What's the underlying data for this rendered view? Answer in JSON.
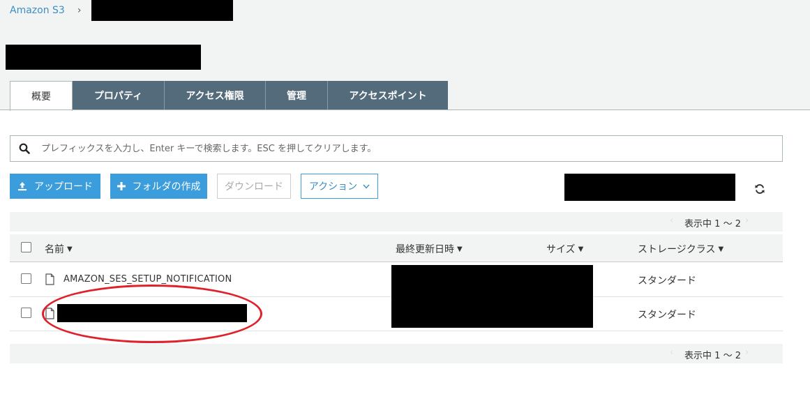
{
  "breadcrumb": {
    "root": "Amazon S3",
    "separator": "›"
  },
  "tabs": [
    {
      "label": "概要",
      "active": true
    },
    {
      "label": "プロパティ",
      "active": false
    },
    {
      "label": "アクセス権限",
      "active": false
    },
    {
      "label": "管理",
      "active": false
    },
    {
      "label": "アクセスポイント",
      "active": false
    }
  ],
  "search": {
    "placeholder": "プレフィックスを入力し、Enter キーで検索します。ESC を押してクリアします。",
    "icon": "search-icon"
  },
  "toolbar": {
    "upload_label": "アップロード",
    "create_folder_label": "フォルダの作成",
    "download_label": "ダウンロード",
    "actions_label": "アクション"
  },
  "pager": {
    "text": "表示中 1 ～ 2",
    "prev": "‹",
    "next": "›"
  },
  "table": {
    "columns": {
      "name": "名前",
      "modified": "最終更新日時",
      "size": "サイズ",
      "storage_class": "ストレージクラス"
    },
    "rows": [
      {
        "name": "AMAZON_SES_SETUP_NOTIFICATION",
        "storage_class": "スタンダード"
      },
      {
        "name": "",
        "storage_class": "スタンダード"
      }
    ]
  },
  "colors": {
    "tab_bg": "#546b7b",
    "primary": "#3b9ddb",
    "link": "#3b8fc4",
    "highlight": "#e0202a",
    "redaction": "#000000"
  }
}
